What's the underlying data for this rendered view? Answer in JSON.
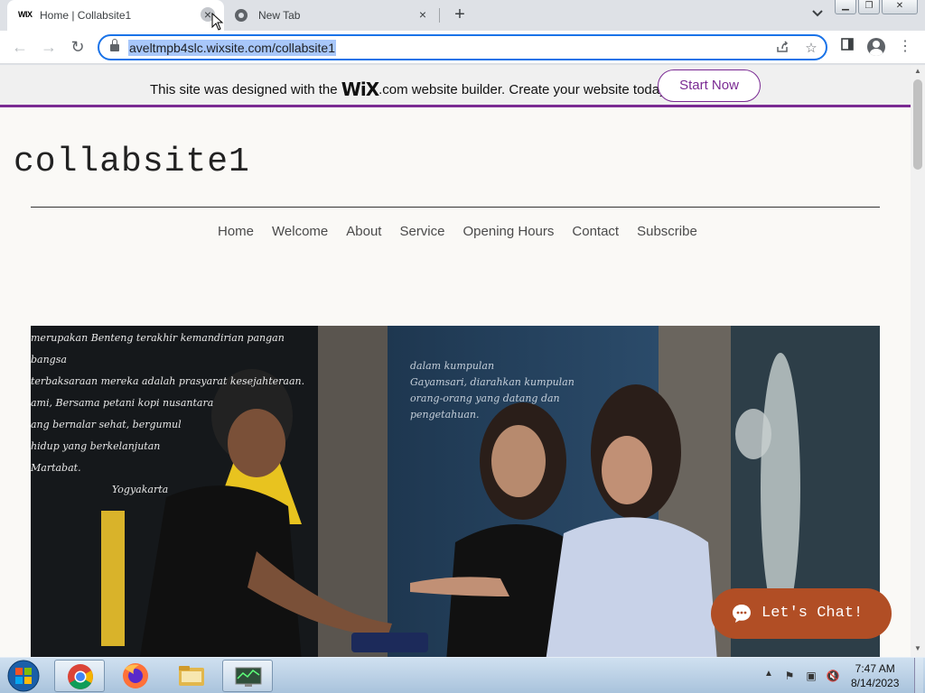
{
  "browser": {
    "tabs": [
      {
        "favicon": "wix-icon",
        "favicon_text": "WIX",
        "title": "Home | Collabsite1",
        "active": true
      },
      {
        "favicon": "chrome-icon",
        "title": "New Tab",
        "active": false
      }
    ],
    "new_tab_symbol": "+",
    "url": "aveltmpb4slc.wixsite.com/collabsite1"
  },
  "wix_banner": {
    "text_before": "This site was designed with the",
    "logo": "WiX",
    "text_after": ".com website builder. Create your website today.",
    "cta": "Start Now",
    "accent_color": "#7a2a93"
  },
  "site": {
    "title": "collabsite1",
    "nav": [
      "Home",
      "Welcome",
      "About",
      "Service",
      "Opening Hours",
      "Contact",
      "Subscribe"
    ],
    "hero_chalkboard_lines": [
      "merupakan Benteng terakhir kemandirian pangan bangsa",
      "terbaksaraan mereka adalah prasyarat kesejahteraan.",
      "ami, Bersama petani kopi nusantara",
      "ang bernalar sehat, bergumul",
      "hidup yang berkelanjutan",
      "Martabat.",
      "Yogyakarta"
    ],
    "hero_window_lines": [
      "dalam kumpulan",
      "Gayamsari, diarahkan kumpulan",
      "orang-orang yang datang dan",
      "pengetahuan."
    ],
    "chat_button": "Let's Chat!",
    "chat_color": "#b14e25"
  },
  "taskbar": {
    "time": "7:47 AM",
    "date": "8/14/2023"
  }
}
